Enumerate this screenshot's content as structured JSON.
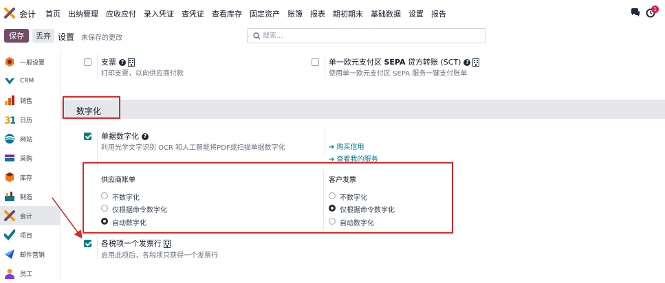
{
  "app": {
    "name": "会计"
  },
  "menu": [
    "首页",
    "出纳管理",
    "应收应付",
    "录入凭证",
    "查凭证",
    "查看库存",
    "固定资产",
    "账簿",
    "报表",
    "期初期末",
    "基础数据",
    "设置",
    "报告"
  ],
  "notifications": {
    "count": "1"
  },
  "controls": {
    "save": "保存",
    "discard": "丢弃",
    "breadcrumb": "设置",
    "unsaved": "未保存的更改",
    "search_placeholder": "搜索..."
  },
  "sidebar": [
    {
      "label": "一般设置",
      "icon": "settings-icon"
    },
    {
      "label": "CRM",
      "icon": "crm-icon"
    },
    {
      "label": "销售",
      "icon": "sales-icon"
    },
    {
      "label": "日历",
      "icon": "calendar-icon"
    },
    {
      "label": "网站",
      "icon": "website-icon"
    },
    {
      "label": "采购",
      "icon": "purchase-icon"
    },
    {
      "label": "库存",
      "icon": "inventory-icon"
    },
    {
      "label": "制造",
      "icon": "manufacturing-icon"
    },
    {
      "label": "会计",
      "icon": "accounting-icon"
    },
    {
      "label": "项目",
      "icon": "project-icon"
    },
    {
      "label": "邮件营销",
      "icon": "email-marketing-icon"
    },
    {
      "label": "员工",
      "icon": "employees-icon"
    }
  ],
  "top_settings": {
    "check": {
      "title": "支票",
      "desc": "打印支票，以向供应商付款",
      "checked": false
    },
    "sepa": {
      "title_prefix": "单一欧元支付区 ",
      "title_bold": "SEPA",
      "title_suffix": " 贷方转账 (SCT)",
      "desc": "使用单一欧元支付区 SEPA 服务一键支付账单",
      "checked": false
    }
  },
  "section": {
    "title": "数字化"
  },
  "digitization": {
    "title": "单据数字化",
    "desc": "利用光学文字识别 OCR 和人工智能将PDF或扫描单据数字化",
    "checked": true,
    "links": [
      "➔ 购买信用",
      "➔ 查看我的服务"
    ],
    "vendor": {
      "heading": "供应商账单",
      "options": [
        "不数字化",
        "仅根据命令数字化",
        "自动数字化"
      ],
      "selected": "自动数字化"
    },
    "customer": {
      "heading": "客户发票",
      "options": [
        "不数字化",
        "仅根据命令数字化",
        "自动数字化"
      ],
      "selected": "仅根据命令数字化"
    }
  },
  "tax_lines": {
    "title": "各税项一个发票行",
    "desc": "启用此项后，各税项只获得一个发票行",
    "checked": true
  },
  "colors": {
    "accent": "#017e84",
    "brand": "#714b67",
    "highlight": "#dc2626"
  }
}
